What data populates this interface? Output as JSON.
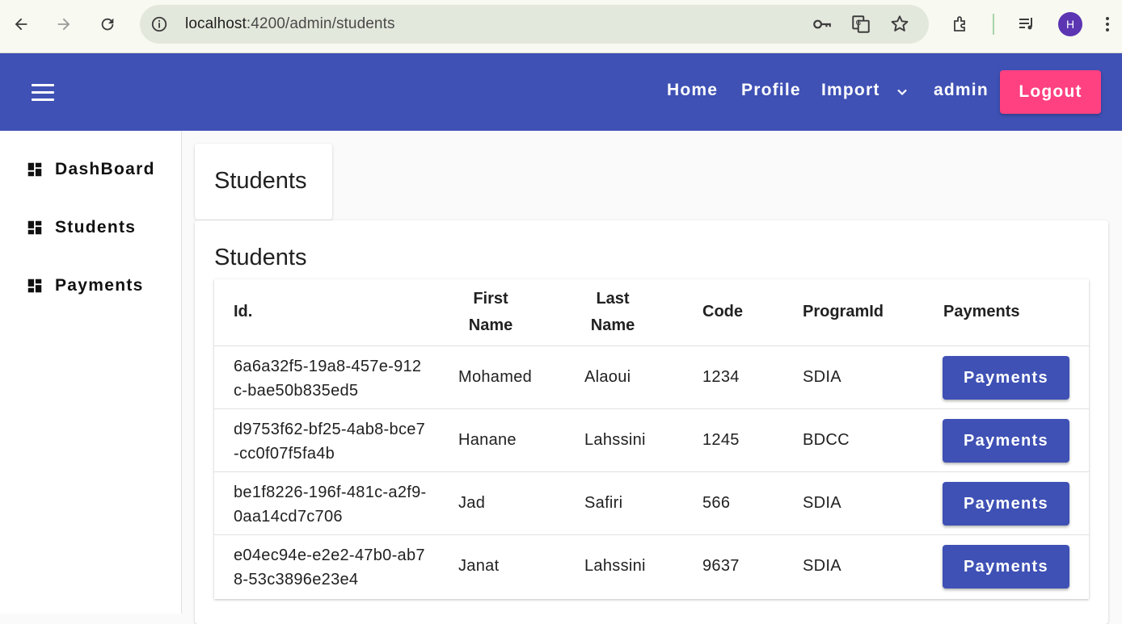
{
  "browser": {
    "url_host": "localhost",
    "url_rest": ":4200/admin/students",
    "profile_initial": "H"
  },
  "toolbar": {
    "home": "Home",
    "profile": "Profile",
    "import": "Import",
    "user": "admin",
    "logout": "Logout",
    "color": "#3f51b5",
    "logout_color": "#ff4081"
  },
  "sidebar": {
    "items": [
      {
        "label": "DashBoard",
        "icon": "dashboard-icon"
      },
      {
        "label": "Students",
        "icon": "dashboard-icon"
      },
      {
        "label": "Payments",
        "icon": "dashboard-icon"
      }
    ]
  },
  "main": {
    "page_title": "Students",
    "card_title": "Students",
    "table": {
      "headers": {
        "id": "Id.",
        "first_1": "First",
        "first_2": "Name",
        "last_1": "Last",
        "last_2": "Name",
        "code": "Code",
        "program": "ProgramId",
        "payments": "Payments"
      },
      "rows": [
        {
          "id": "6a6a32f5-19a8-457e-912c-bae50b835ed5",
          "first": "Mohamed",
          "last": "Alaoui",
          "code": "1234",
          "program": "SDIA",
          "action": "Payments"
        },
        {
          "id": "d9753f62-bf25-4ab8-bce7-cc0f07f5fa4b",
          "first": "Hanane",
          "last": "Lahssini",
          "code": "1245",
          "program": "BDCC",
          "action": "Payments"
        },
        {
          "id": "be1f8226-196f-481c-a2f9-0aa14cd7c706",
          "first": "Jad",
          "last": "Safiri",
          "code": "566",
          "program": "SDIA",
          "action": "Payments"
        },
        {
          "id": "e04ec94e-e2e2-47b0-ab78-53c3896e23e4",
          "first": "Janat",
          "last": "Lahssini",
          "code": "9637",
          "program": "SDIA",
          "action": "Payments"
        }
      ]
    }
  }
}
